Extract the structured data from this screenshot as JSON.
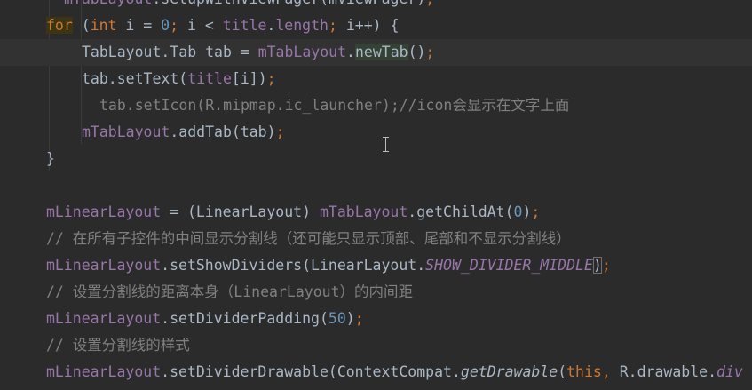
{
  "editor": {
    "lines": [
      {
        "id": "setup",
        "tokens": [
          {
            "t": "mTabLayout",
            "c": "field"
          },
          {
            "t": ".setupWithViewPager(mViewPager)",
            "c": ""
          },
          {
            "t": ";",
            "c": "semi"
          }
        ]
      },
      {
        "id": "for",
        "tokens": [
          {
            "t": "for",
            "c": "kw for-hl"
          },
          {
            "t": " (",
            "c": ""
          },
          {
            "t": "int",
            "c": "kw"
          },
          {
            "t": " i = ",
            "c": ""
          },
          {
            "t": "0",
            "c": "num"
          },
          {
            "t": "; ",
            "c": "semi"
          },
          {
            "t": "i < ",
            "c": ""
          },
          {
            "t": "title",
            "c": "field"
          },
          {
            "t": ".",
            "c": ""
          },
          {
            "t": "length",
            "c": "field"
          },
          {
            "t": "; ",
            "c": "semi"
          },
          {
            "t": "i++) {",
            "c": ""
          }
        ]
      },
      {
        "id": "newtab",
        "tokens": [
          {
            "t": "TabLayout.Tab tab = ",
            "c": ""
          },
          {
            "t": "mTabLayout",
            "c": "field"
          },
          {
            "t": ".",
            "c": ""
          },
          {
            "t": "newTab",
            "c": "ident-hl"
          },
          {
            "t": "()",
            "c": ""
          },
          {
            "t": ";",
            "c": "semi"
          }
        ]
      },
      {
        "id": "settext",
        "tokens": [
          {
            "t": "tab.setText(",
            "c": ""
          },
          {
            "t": "title",
            "c": "field"
          },
          {
            "t": "[i])",
            "c": ""
          },
          {
            "t": ";",
            "c": "semi"
          }
        ]
      },
      {
        "id": "seticon",
        "tokens": [
          {
            "t": "tab.setIcon(R.mipmap.ic_launcher);//icon会显示在文字上面",
            "c": "comment"
          }
        ]
      },
      {
        "id": "addtab",
        "tokens": [
          {
            "t": "mTabLayout",
            "c": "field"
          },
          {
            "t": ".addTab(tab)",
            "c": ""
          },
          {
            "t": ";",
            "c": "semi"
          }
        ]
      },
      {
        "id": "closebrace",
        "tokens": [
          {
            "t": "}",
            "c": ""
          }
        ]
      },
      {
        "id": "blank",
        "tokens": []
      },
      {
        "id": "getchild",
        "tokens": [
          {
            "t": "mLinearLayout",
            "c": "field"
          },
          {
            "t": " = (LinearLayout) ",
            "c": ""
          },
          {
            "t": "mTabLayout",
            "c": "field"
          },
          {
            "t": ".getChildAt(",
            "c": ""
          },
          {
            "t": "0",
            "c": "num"
          },
          {
            "t": ")",
            "c": ""
          },
          {
            "t": ";",
            "c": "semi"
          }
        ]
      },
      {
        "id": "comment1",
        "tokens": [
          {
            "t": "// 在所有子控件的中间显示分割线（还可能只显示顶部、尾部和不显示分割线）",
            "c": "comment"
          }
        ]
      },
      {
        "id": "showdividers",
        "tokens": [
          {
            "t": "mLinearLayout",
            "c": "field"
          },
          {
            "t": ".setShowDividers(LinearLayout.",
            "c": ""
          },
          {
            "t": "SHOW_DIVIDER_MIDDLE",
            "c": "stat"
          },
          {
            "t": ")",
            "c": "paren-hl"
          },
          {
            "t": ";",
            "c": "semi"
          }
        ]
      },
      {
        "id": "comment2",
        "tokens": [
          {
            "t": "// 设置分割线的距离本身（LinearLayout）的内间距",
            "c": "comment"
          }
        ]
      },
      {
        "id": "dividerpadding",
        "tokens": [
          {
            "t": "mLinearLayout",
            "c": "field"
          },
          {
            "t": ".setDividerPadding(",
            "c": ""
          },
          {
            "t": "50",
            "c": "num"
          },
          {
            "t": ")",
            "c": ""
          },
          {
            "t": ";",
            "c": "semi"
          }
        ]
      },
      {
        "id": "comment3",
        "tokens": [
          {
            "t": "// 设置分割线的样式",
            "c": "comment"
          }
        ]
      },
      {
        "id": "dividerdrawable",
        "tokens": [
          {
            "t": "mLinearLayout",
            "c": "field"
          },
          {
            "t": ".setDividerDrawable(ContextCompat.",
            "c": ""
          },
          {
            "t": "getDrawable",
            "c": "method-static"
          },
          {
            "t": "(",
            "c": ""
          },
          {
            "t": "this,",
            "c": "kw"
          },
          {
            "t": " R.drawable.",
            "c": ""
          },
          {
            "t": "div",
            "c": "stat"
          }
        ]
      }
    ]
  }
}
